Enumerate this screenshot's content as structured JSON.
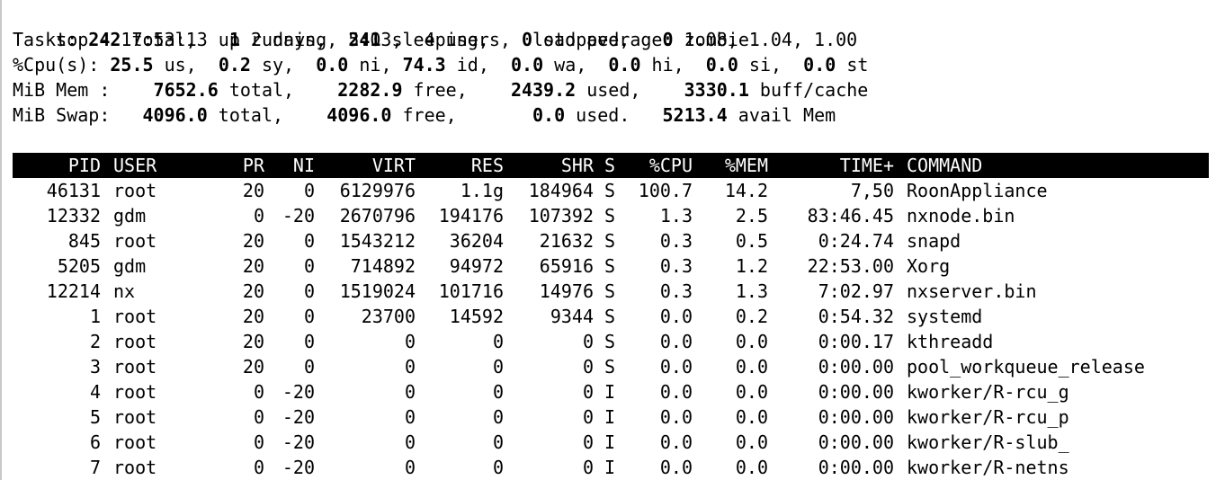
{
  "summary": {
    "line1": "top - 17:53:13 up 2 days,  5:03,  4 users,  load average: 1.08, 1.04, 1.00",
    "tasks": {
      "label": "Tasks:",
      "total": "242",
      "total_label": " total,",
      "running": "1",
      "running_label": " running,",
      "sleeping": "241",
      "sleeping_label": " sleeping,",
      "stopped": "0",
      "stopped_label": " stopped,",
      "zombie": "0",
      "zombie_label": " zombie"
    },
    "cpu": {
      "label": "%Cpu(s):",
      "us": "25.5",
      "us_label": " us,",
      "sy": "0.2",
      "sy_label": " sy,",
      "ni": "0.0",
      "ni_label": " ni,",
      "id": "74.3",
      "id_label": " id,",
      "wa": "0.0",
      "wa_label": " wa,",
      "hi": "0.0",
      "hi_label": " hi,",
      "si": "0.0",
      "si_label": " si,",
      "st": "0.0",
      "st_label": " st"
    },
    "mem": {
      "label": "MiB Mem :",
      "total": "7652.6",
      "total_label": " total,",
      "free": "2282.9",
      "free_label": " free,",
      "used": "2439.2",
      "used_label": " used,",
      "cache": "3330.1",
      "cache_label": " buff/cache"
    },
    "swap": {
      "label": "MiB Swap:",
      "total": "4096.0",
      "total_label": " total,",
      "free": "4096.0",
      "free_label": " free,",
      "used": "0.0",
      "used_label": " used.",
      "avail": "5213.4",
      "avail_label": " avail Mem"
    }
  },
  "columns": [
    "PID",
    "USER",
    "PR",
    "NI",
    "VIRT",
    "RES",
    "SHR",
    "S",
    "%CPU",
    "%MEM",
    "TIME+",
    "COMMAND"
  ],
  "processes": [
    [
      "46131",
      "root",
      "20",
      "0",
      "6129976",
      "1.1g",
      "184964",
      "S",
      "100.7",
      "14.2",
      "7,50",
      "RoonAppliance"
    ],
    [
      "12332",
      "gdm",
      "0",
      "-20",
      "2670796",
      "194176",
      "107392",
      "S",
      "1.3",
      "2.5",
      "83:46.45",
      "nxnode.bin"
    ],
    [
      "845",
      "root",
      "20",
      "0",
      "1543212",
      "36204",
      "21632",
      "S",
      "0.3",
      "0.5",
      "0:24.74",
      "snapd"
    ],
    [
      "5205",
      "gdm",
      "20",
      "0",
      "714892",
      "94972",
      "65916",
      "S",
      "0.3",
      "1.2",
      "22:53.00",
      "Xorg"
    ],
    [
      "12214",
      "nx",
      "20",
      "0",
      "1519024",
      "101716",
      "14976",
      "S",
      "0.3",
      "1.3",
      "7:02.97",
      "nxserver.bin"
    ],
    [
      "1",
      "root",
      "20",
      "0",
      "23700",
      "14592",
      "9344",
      "S",
      "0.0",
      "0.2",
      "0:54.32",
      "systemd"
    ],
    [
      "2",
      "root",
      "20",
      "0",
      "0",
      "0",
      "0",
      "S",
      "0.0",
      "0.0",
      "0:00.17",
      "kthreadd"
    ],
    [
      "3",
      "root",
      "20",
      "0",
      "0",
      "0",
      "0",
      "S",
      "0.0",
      "0.0",
      "0:00.00",
      "pool_workqueue_release"
    ],
    [
      "4",
      "root",
      "0",
      "-20",
      "0",
      "0",
      "0",
      "I",
      "0.0",
      "0.0",
      "0:00.00",
      "kworker/R-rcu_g"
    ],
    [
      "5",
      "root",
      "0",
      "-20",
      "0",
      "0",
      "0",
      "I",
      "0.0",
      "0.0",
      "0:00.00",
      "kworker/R-rcu_p"
    ],
    [
      "6",
      "root",
      "0",
      "-20",
      "0",
      "0",
      "0",
      "I",
      "0.0",
      "0.0",
      "0:00.00",
      "kworker/R-slub_"
    ],
    [
      "7",
      "root",
      "0",
      "-20",
      "0",
      "0",
      "0",
      "I",
      "0.0",
      "0.0",
      "0:00.00",
      "kworker/R-netns"
    ]
  ]
}
